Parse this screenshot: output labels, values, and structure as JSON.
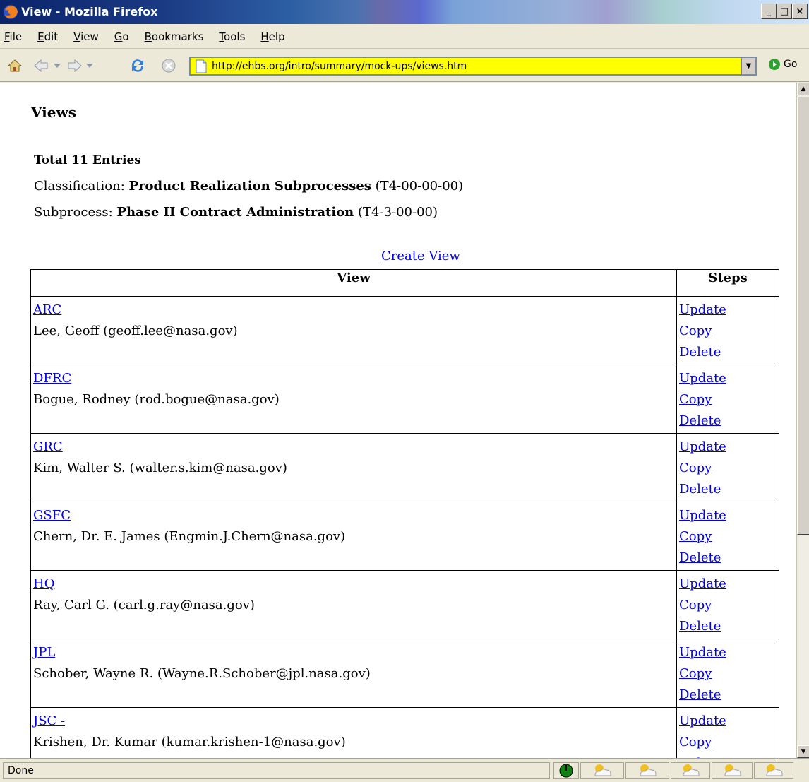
{
  "window": {
    "title": "View - Mozilla Firefox",
    "minimize": "_",
    "maximize": "□",
    "close": "×"
  },
  "menu": [
    {
      "key": "F",
      "rest": "ile"
    },
    {
      "key": "E",
      "rest": "dit"
    },
    {
      "key": "V",
      "rest": "iew"
    },
    {
      "key": "G",
      "rest": "o"
    },
    {
      "key": "B",
      "rest": "ookmarks"
    },
    {
      "key": "T",
      "rest": "ools"
    },
    {
      "key": "H",
      "rest": "elp"
    }
  ],
  "nav": {
    "url": "http://ehbs.org/intro/summary/mock-ups/views.htm",
    "go_label": "Go"
  },
  "page": {
    "title": "Views",
    "total": "Total 11 Entries",
    "classification_label": "Classification: ",
    "classification_name": "Product Realization Subprocesses",
    "classification_code": " (T4-00-00-00)",
    "subprocess_label": "Subprocess: ",
    "subprocess_name": "Phase II Contract Administration",
    "subprocess_code": " (T4-3-00-00)",
    "create_view": "Create View"
  },
  "table": {
    "headers": [
      "View",
      "Steps"
    ],
    "steps": [
      "Update",
      "Copy",
      "Delete"
    ],
    "rows": [
      {
        "view": "ARC",
        "contact": "Lee, Geoff (geoff.lee@nasa.gov)"
      },
      {
        "view": "DFRC",
        "contact": "Bogue, Rodney (rod.bogue@nasa.gov)"
      },
      {
        "view": "GRC",
        "contact": "Kim, Walter S. (walter.s.kim@nasa.gov)"
      },
      {
        "view": "GSFC",
        "contact": "Chern, Dr. E. James (Engmin.J.Chern@nasa.gov)"
      },
      {
        "view": "HQ",
        "contact": "Ray, Carl G. (carl.g.ray@nasa.gov)"
      },
      {
        "view": "JPL",
        "contact": "Schober, Wayne R. (Wayne.R.Schober@jpl.nasa.gov)"
      },
      {
        "view": "JSC -",
        "contact": "Krishen, Dr. Kumar (kumar.krishen-1@nasa.gov)"
      }
    ]
  },
  "status": {
    "text": "Done"
  }
}
